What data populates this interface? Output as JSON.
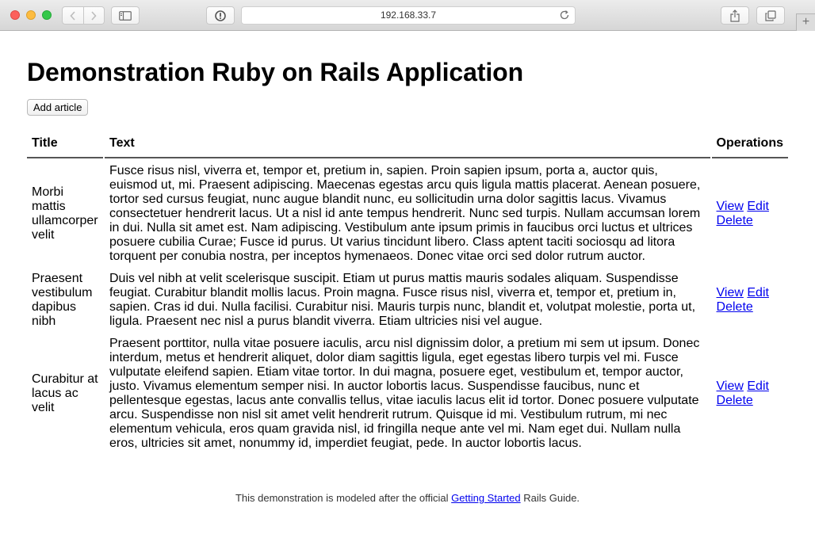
{
  "browser": {
    "address": "192.168.33.7",
    "icons": {
      "back": "chevron-left-icon",
      "forward": "chevron-right-icon",
      "sidebar": "sidebar-icon",
      "reader": "reader-icon",
      "reload": "reload-icon",
      "share": "share-icon",
      "tabs": "tabs-overview-icon",
      "new_tab": "plus-icon"
    },
    "new_tab_label": "+"
  },
  "page": {
    "heading": "Demonstration Ruby on Rails Application",
    "add_button": "Add article"
  },
  "table": {
    "headers": {
      "title": "Title",
      "text": "Text",
      "operations": "Operations"
    },
    "rows": [
      {
        "title": "Morbi mattis ullamcorper velit",
        "text": "Fusce risus nisl, viverra et, tempor et, pretium in, sapien. Proin sapien ipsum, porta a, auctor quis, euismod ut, mi. Praesent adipiscing. Maecenas egestas arcu quis ligula mattis placerat. Aenean posuere, tortor sed cursus feugiat, nunc augue blandit nunc, eu sollicitudin urna dolor sagittis lacus. Vivamus consectetuer hendrerit lacus. Ut a nisl id ante tempus hendrerit. Nunc sed turpis. Nullam accumsan lorem in dui. Nulla sit amet est. Nam adipiscing. Vestibulum ante ipsum primis in faucibus orci luctus et ultrices posuere cubilia Curae; Fusce id purus. Ut varius tincidunt libero. Class aptent taciti sociosqu ad litora torquent per conubia nostra, per inceptos hymenaeos. Donec vitae orci sed dolor rutrum auctor.",
        "view": "View",
        "edit": "Edit",
        "delete": "Delete"
      },
      {
        "title": "Praesent vestibulum dapibus nibh",
        "text": "Duis vel nibh at velit scelerisque suscipit. Etiam ut purus mattis mauris sodales aliquam. Suspendisse feugiat. Curabitur blandit mollis lacus. Proin magna. Fusce risus nisl, viverra et, tempor et, pretium in, sapien. Cras id dui. Nulla facilisi. Curabitur nisi. Mauris turpis nunc, blandit et, volutpat molestie, porta ut, ligula. Praesent nec nisl a purus blandit viverra. Etiam ultricies nisi vel augue.",
        "view": "View",
        "edit": "Edit",
        "delete": "Delete"
      },
      {
        "title": "Curabitur at lacus ac velit",
        "text": "Praesent porttitor, nulla vitae posuere iaculis, arcu nisl dignissim dolor, a pretium mi sem ut ipsum. Donec interdum, metus et hendrerit aliquet, dolor diam sagittis ligula, eget egestas libero turpis vel mi. Fusce vulputate eleifend sapien. Etiam vitae tortor. In dui magna, posuere eget, vestibulum et, tempor auctor, justo. Vivamus elementum semper nisi. In auctor lobortis lacus. Suspendisse faucibus, nunc et pellentesque egestas, lacus ante convallis tellus, vitae iaculis lacus elit id tortor. Donec posuere vulputate arcu. Suspendisse non nisl sit amet velit hendrerit rutrum. Quisque id mi. Vestibulum rutrum, mi nec elementum vehicula, eros quam gravida nisl, id fringilla neque ante vel mi. Nam eget dui. Nullam nulla eros, ultricies sit amet, nonummy id, imperdiet feugiat, pede. In auctor lobortis lacus.",
        "view": "View",
        "edit": "Edit",
        "delete": "Delete"
      }
    ]
  },
  "footer": {
    "prefix": "This demonstration is modeled after the official ",
    "link": "Getting Started",
    "suffix": " Rails Guide."
  },
  "colors": {
    "link": "#0000ee",
    "close": "#fc605c",
    "minimize": "#fdbc40",
    "zoom": "#34c84a"
  }
}
